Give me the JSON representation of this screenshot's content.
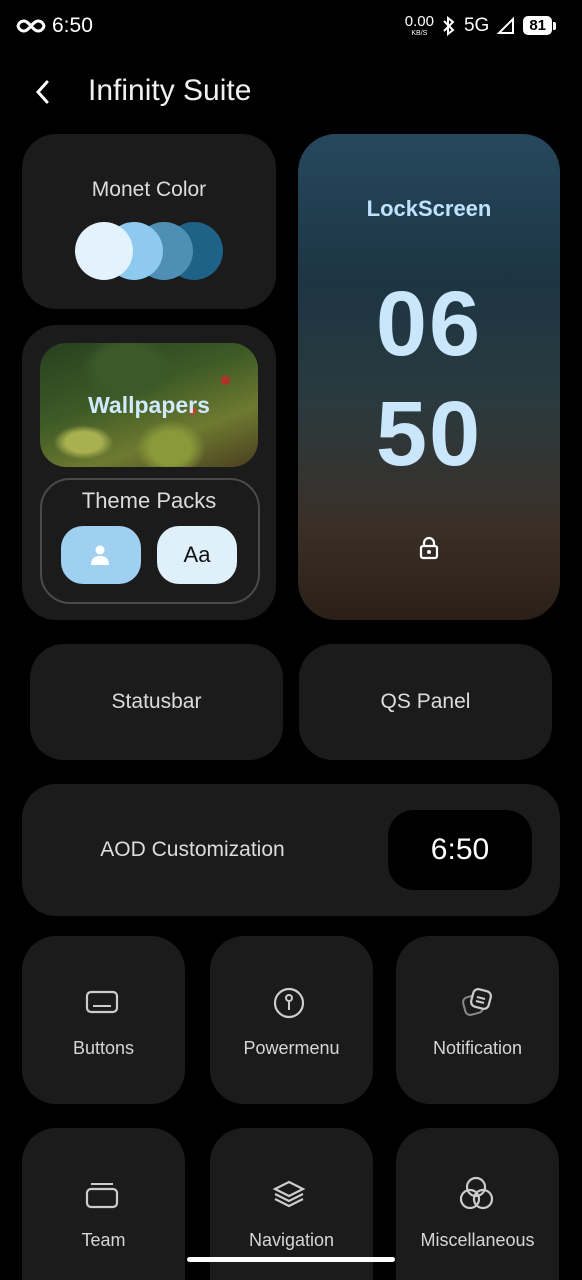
{
  "status_bar": {
    "time": "6:50",
    "net_speed": "0.00",
    "net_unit": "KB/S",
    "network": "5G",
    "battery": "81"
  },
  "header": {
    "title": "Infinity Suite"
  },
  "monet": {
    "label": "Monet Color",
    "colors": [
      "#e4f2fd",
      "#8ecaf0",
      "#4f8fb6",
      "#1f6288"
    ]
  },
  "lockscreen": {
    "label": "LockScreen",
    "hour": "06",
    "minute": "50"
  },
  "wallpapers": {
    "label": "Wallpapers"
  },
  "theme_packs": {
    "label": "Theme Packs",
    "font_button": "Aa"
  },
  "statusbar": {
    "label": "Statusbar"
  },
  "qs_panel": {
    "label": "QS Panel"
  },
  "aod": {
    "label": "AOD Customization",
    "time": "6:50"
  },
  "tiles": [
    {
      "label": "Buttons",
      "icon": "button-icon"
    },
    {
      "label": "Powermenu",
      "icon": "power-icon"
    },
    {
      "label": "Notification",
      "icon": "notification-icon"
    },
    {
      "label": "Team",
      "icon": "team-icon"
    },
    {
      "label": "Navigation",
      "icon": "layers-icon"
    },
    {
      "label": "Miscellaneous",
      "icon": "circles-icon"
    }
  ],
  "colors": {
    "accent": "#9fd0f2",
    "card": "#1b1b1b",
    "background": "#000000"
  }
}
